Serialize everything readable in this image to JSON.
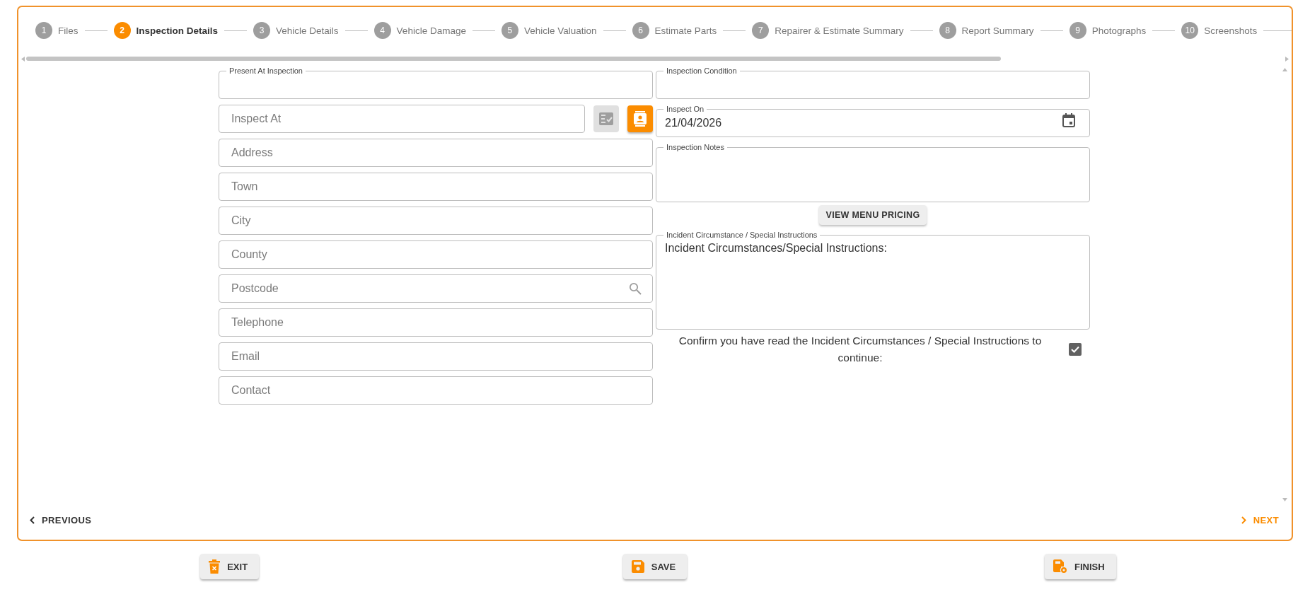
{
  "steps": [
    {
      "number": "1",
      "label": "Files",
      "selected": false
    },
    {
      "number": "2",
      "label": "Inspection Details",
      "selected": true
    },
    {
      "number": "3",
      "label": "Vehicle Details",
      "selected": false
    },
    {
      "number": "4",
      "label": "Vehicle Damage",
      "selected": false
    },
    {
      "number": "5",
      "label": "Vehicle Valuation",
      "selected": false
    },
    {
      "number": "6",
      "label": "Estimate Parts",
      "selected": false
    },
    {
      "number": "7",
      "label": "Repairer & Estimate Summary",
      "selected": false
    },
    {
      "number": "8",
      "label": "Report Summary",
      "selected": false
    },
    {
      "number": "9",
      "label": "Photographs",
      "selected": false
    },
    {
      "number": "10",
      "label": "Screenshots",
      "selected": false
    }
  ],
  "left_fields": [
    {
      "kind": "text",
      "label": "Present At Inspection"
    },
    {
      "kind": "with_buttons",
      "placeholder": "Inspect At",
      "buttons": [
        {
          "kind": "checklist",
          "disabled": true
        },
        {
          "kind": "contact",
          "disabled": false
        }
      ]
    },
    {
      "kind": "text",
      "placeholder": "Address"
    },
    {
      "kind": "text",
      "placeholder": "Town"
    },
    {
      "kind": "text",
      "placeholder": "City"
    },
    {
      "kind": "text",
      "placeholder": "County"
    },
    {
      "kind": "search",
      "placeholder": "Postcode"
    },
    {
      "kind": "text",
      "placeholder": "Telephone"
    },
    {
      "kind": "text",
      "placeholder": "Email"
    },
    {
      "kind": "text",
      "placeholder": "Contact"
    }
  ],
  "right_fields": [
    {
      "kind": "text",
      "label": "Inspection Condition"
    },
    {
      "kind": "date",
      "label": "Inspect On",
      "value": "21/04/2026"
    },
    {
      "kind": "notes",
      "label": "Inspection Notes"
    },
    {
      "kind": "button",
      "text": "VIEW MENU PRICING"
    },
    {
      "kind": "textarea",
      "label": "Incident Circumstance / Special Instructions",
      "value": "Incident Circumstances/Special Instructions:"
    }
  ],
  "confirm": {
    "text": "Confirm you have read the Incident Circumstances / Special Instructions to continue:",
    "checked": true
  },
  "nav": {
    "previous": "PREVIOUS",
    "next": "NEXT"
  },
  "actions": [
    {
      "kind": "exit",
      "label": "EXIT"
    },
    {
      "kind": "save",
      "label": "SAVE"
    },
    {
      "kind": "finish",
      "label": "FINISH"
    }
  ]
}
